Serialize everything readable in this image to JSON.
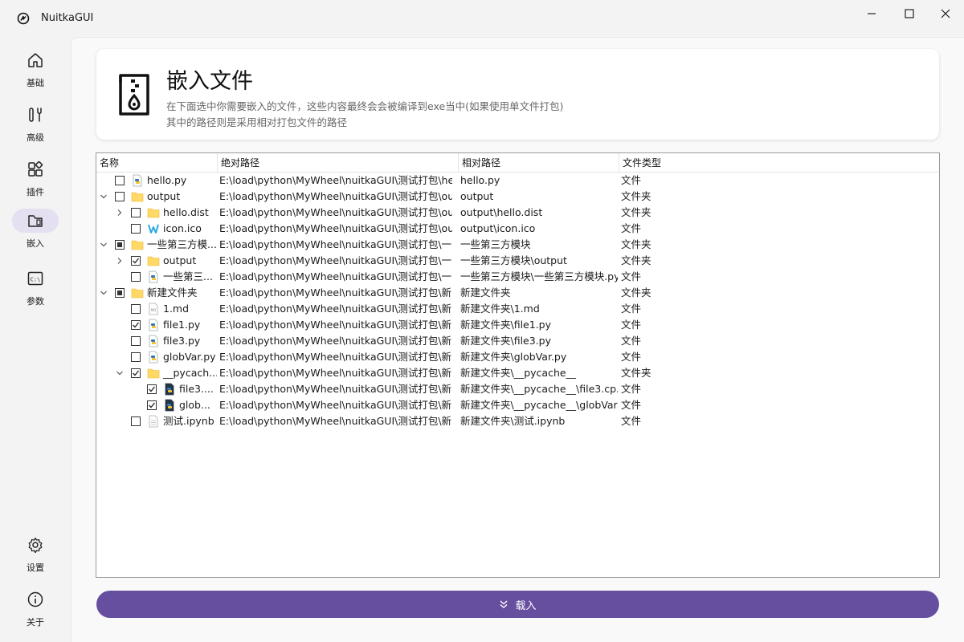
{
  "window": {
    "title": "NuitkaGUI",
    "min_icon": "minimize-icon",
    "max_icon": "maximize-icon",
    "close_icon": "close-icon"
  },
  "sidebar": {
    "items": [
      {
        "label": "基础",
        "icon": "home-icon"
      },
      {
        "label": "高级",
        "icon": "tools-icon"
      },
      {
        "label": "插件",
        "icon": "plugin-icon"
      },
      {
        "label": "嵌入",
        "icon": "folder-embed-icon",
        "active": true
      },
      {
        "label": "参数",
        "icon": "command-line-icon"
      }
    ],
    "bottom_items": [
      {
        "label": "设置",
        "icon": "gear-icon"
      },
      {
        "label": "关于",
        "icon": "info-icon"
      }
    ]
  },
  "header": {
    "title": "嵌入文件",
    "desc_line1": "在下面选中你需要嵌入的文件，这些内容最终会会被编译到exe当中(如果使用单文件打包)",
    "desc_line2": "其中的路径则是采用相对打包文件的路径",
    "icon": "zip-file-icon"
  },
  "tree": {
    "columns": [
      "名称",
      "绝对路径",
      "相对路径",
      "文件类型"
    ],
    "rows": [
      {
        "depth": 0,
        "arrow": "",
        "check": "unchecked",
        "icon": "python-file-icon",
        "name": "hello.py",
        "abs": "E:\\load\\python\\MyWheel\\nuitkaGUI\\测试打包\\hel...",
        "rel": "hello.py",
        "type": "文件"
      },
      {
        "depth": 0,
        "arrow": "down",
        "check": "unchecked",
        "icon": "folder-icon",
        "name": "output",
        "abs": "E:\\load\\python\\MyWheel\\nuitkaGUI\\测试打包\\ou...",
        "rel": "output",
        "type": "文件夹"
      },
      {
        "depth": 1,
        "arrow": "right",
        "check": "unchecked",
        "icon": "folder-icon",
        "name": "hello.dist",
        "abs": "E:\\load\\python\\MyWheel\\nuitkaGUI\\测试打包\\ou...",
        "rel": "output\\hello.dist",
        "type": "文件夹"
      },
      {
        "depth": 1,
        "arrow": "",
        "check": "unchecked",
        "icon": "nuitka-icon",
        "name": "icon.ico",
        "abs": "E:\\load\\python\\MyWheel\\nuitkaGUI\\测试打包\\ou...",
        "rel": "output\\icon.ico",
        "type": "文件"
      },
      {
        "depth": 0,
        "arrow": "down",
        "check": "partial",
        "icon": "folder-icon",
        "name": "一些第三方模...",
        "abs": "E:\\load\\python\\MyWheel\\nuitkaGUI\\测试打包\\一...",
        "rel": "一些第三方模块",
        "type": "文件夹"
      },
      {
        "depth": 1,
        "arrow": "right",
        "check": "checked",
        "icon": "folder-icon",
        "name": "output",
        "abs": "E:\\load\\python\\MyWheel\\nuitkaGUI\\测试打包\\一...",
        "rel": "一些第三方模块\\output",
        "type": "文件夹"
      },
      {
        "depth": 1,
        "arrow": "",
        "check": "unchecked",
        "icon": "python-file-icon",
        "name": "一些第三...",
        "abs": "E:\\load\\python\\MyWheel\\nuitkaGUI\\测试打包\\一...",
        "rel": "一些第三方模块\\一些第三方模块.py",
        "type": "文件"
      },
      {
        "depth": 0,
        "arrow": "down",
        "check": "partial",
        "icon": "folder-icon",
        "name": "新建文件夹",
        "abs": "E:\\load\\python\\MyWheel\\nuitkaGUI\\测试打包\\新...",
        "rel": "新建文件夹",
        "type": "文件夹"
      },
      {
        "depth": 1,
        "arrow": "",
        "check": "unchecked",
        "icon": "markdown-file-icon",
        "name": "1.md",
        "abs": "E:\\load\\python\\MyWheel\\nuitkaGUI\\测试打包\\新...",
        "rel": "新建文件夹\\1.md",
        "type": "文件"
      },
      {
        "depth": 1,
        "arrow": "",
        "check": "checked",
        "icon": "python-file-icon",
        "name": "file1.py",
        "abs": "E:\\load\\python\\MyWheel\\nuitkaGUI\\测试打包\\新...",
        "rel": "新建文件夹\\file1.py",
        "type": "文件"
      },
      {
        "depth": 1,
        "arrow": "",
        "check": "unchecked",
        "icon": "python-file-icon",
        "name": "file3.py",
        "abs": "E:\\load\\python\\MyWheel\\nuitkaGUI\\测试打包\\新...",
        "rel": "新建文件夹\\file3.py",
        "type": "文件"
      },
      {
        "depth": 1,
        "arrow": "",
        "check": "unchecked",
        "icon": "python-file-icon",
        "name": "globVar.py",
        "abs": "E:\\load\\python\\MyWheel\\nuitkaGUI\\测试打包\\新...",
        "rel": "新建文件夹\\globVar.py",
        "type": "文件"
      },
      {
        "depth": 1,
        "arrow": "down",
        "check": "checked",
        "icon": "folder-icon",
        "name": "__pycach...",
        "abs": "E:\\load\\python\\MyWheel\\nuitkaGUI\\测试打包\\新...",
        "rel": "新建文件夹\\__pycache__",
        "type": "文件夹"
      },
      {
        "depth": 2,
        "arrow": "",
        "check": "checked",
        "icon": "python-compiled-icon",
        "name": "file3....",
        "abs": "E:\\load\\python\\MyWheel\\nuitkaGUI\\测试打包\\新...",
        "rel": "新建文件夹\\__pycache__\\file3.cp...",
        "type": "文件"
      },
      {
        "depth": 2,
        "arrow": "",
        "check": "checked",
        "icon": "python-compiled-icon",
        "name": "glob...",
        "abs": "E:\\load\\python\\MyWheel\\nuitkaGUI\\测试打包\\新...",
        "rel": "新建文件夹\\__pycache__\\globVar...",
        "type": "文件"
      },
      {
        "depth": 1,
        "arrow": "",
        "check": "unchecked",
        "icon": "generic-file-icon",
        "name": "测试.ipynb",
        "abs": "E:\\load\\python\\MyWheel\\nuitkaGUI\\测试打包\\新...",
        "rel": "新建文件夹\\测试.ipynb",
        "type": "文件"
      }
    ]
  },
  "load_button": {
    "label": "载入",
    "icon": "double-chevron-down-icon"
  },
  "colors": {
    "accent": "#674fa0",
    "active_nav": "#e4e0f1",
    "folder": "#ffd866"
  }
}
